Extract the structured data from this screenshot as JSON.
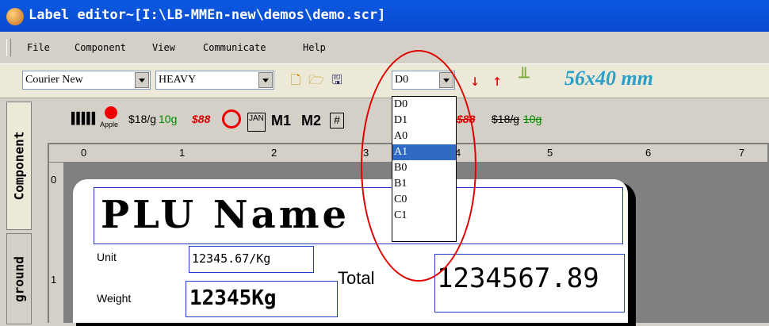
{
  "window": {
    "title": "Label editor~[I:\\LB-MMEn-new\\demos\\demo.scr]"
  },
  "menu": {
    "items": [
      "File",
      "Component",
      "View",
      "Communicate",
      "Help"
    ]
  },
  "toolbar": {
    "font_name": "Courier New",
    "font_weight": "HEAVY",
    "resolution": "D0",
    "label_size": "56x40 mm",
    "icons": [
      "new-document-icon",
      "open-folder-icon",
      "save-disk-icon",
      "arrow-down-icon",
      "arrow-up-icon",
      "adjust-icon"
    ]
  },
  "dropdown": {
    "options": [
      "D0",
      "D1",
      "A0",
      "A1",
      "B0",
      "B1",
      "C0",
      "C1"
    ],
    "selected": "A1"
  },
  "side_tabs": {
    "component": "Component",
    "background": "ground"
  },
  "component_toolbar": {
    "items": [
      "barcode",
      "Apple",
      "$18/g",
      "10g",
      "$88",
      "no-icon",
      "JAN",
      "M1",
      "M2",
      "#",
      "$88",
      "$18/g",
      "10g"
    ],
    "apple_label": "Apple",
    "price_per": "$18/g",
    "weight": "10g",
    "price": "$88",
    "jan": "JAN",
    "m1": "M1",
    "m2": "M2",
    "hash": "#"
  },
  "ruler": {
    "labels": [
      "0",
      "1",
      "2",
      "3",
      "4",
      "5",
      "6",
      "7"
    ]
  },
  "label": {
    "plu_name": "PLU Name",
    "unit_label": "Unit",
    "unit_value": "12345.67/Kg",
    "weight_label": "Weight",
    "weight_value": "12345Kg",
    "total_label": "Total",
    "total_value": "1234567.89"
  },
  "colors": {
    "titlebar": "#0a49d1",
    "selection": "#316ac5",
    "accent_size": "#2aa0c8",
    "annotation": "#e00000",
    "field_border": "#1e3cc8"
  }
}
